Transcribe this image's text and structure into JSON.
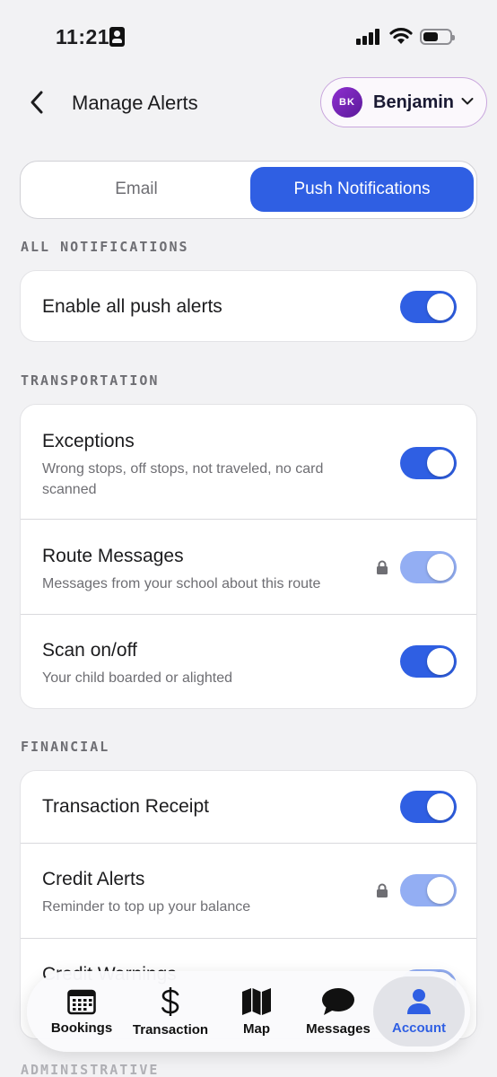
{
  "status_bar": {
    "time": "11:21"
  },
  "header": {
    "title": "Manage Alerts",
    "account": {
      "initials": "BK",
      "name": "Benjamin"
    }
  },
  "tabs": {
    "email": "Email",
    "push": "Push Notifications",
    "selected": "Push Notifications"
  },
  "sections": {
    "all": {
      "label": "ALL NOTIFICATIONS",
      "rows": [
        {
          "title": "Enable all push alerts",
          "enabled": true
        }
      ]
    },
    "transportation": {
      "label": "TRANSPORTATION",
      "rows": [
        {
          "title": "Exceptions",
          "subtitle": "Wrong stops, off stops, not traveled, no card scanned",
          "enabled": true,
          "locked": false
        },
        {
          "title": "Route Messages",
          "subtitle": "Messages from your school about this route",
          "enabled": true,
          "locked": true
        },
        {
          "title": "Scan on/off",
          "subtitle": "Your child boarded or alighted",
          "enabled": true,
          "locked": false
        }
      ]
    },
    "financial": {
      "label": "FINANCIAL",
      "rows": [
        {
          "title": "Transaction Receipt",
          "enabled": true,
          "locked": false
        },
        {
          "title": "Credit Alerts",
          "subtitle": "Reminder to top up your balance",
          "enabled": true,
          "locked": true
        },
        {
          "title": "Credit Warnings",
          "enabled": true,
          "locked": true
        }
      ]
    },
    "administrative": {
      "label": "ADMINISTRATIVE"
    }
  },
  "tab_bar": {
    "items": [
      {
        "label": "Bookings",
        "icon": "calendar-icon"
      },
      {
        "label": "Transaction",
        "icon": "dollar-icon"
      },
      {
        "label": "Map",
        "icon": "map-icon"
      },
      {
        "label": "Messages",
        "icon": "chat-bubble-icon"
      },
      {
        "label": "Account",
        "icon": "person-icon"
      }
    ],
    "active": "Account"
  },
  "colors": {
    "accent": "#2f5fe3",
    "accent_disabled": "#93aef3",
    "avatar": "#7b26bd",
    "background": "#f2f2f4"
  }
}
